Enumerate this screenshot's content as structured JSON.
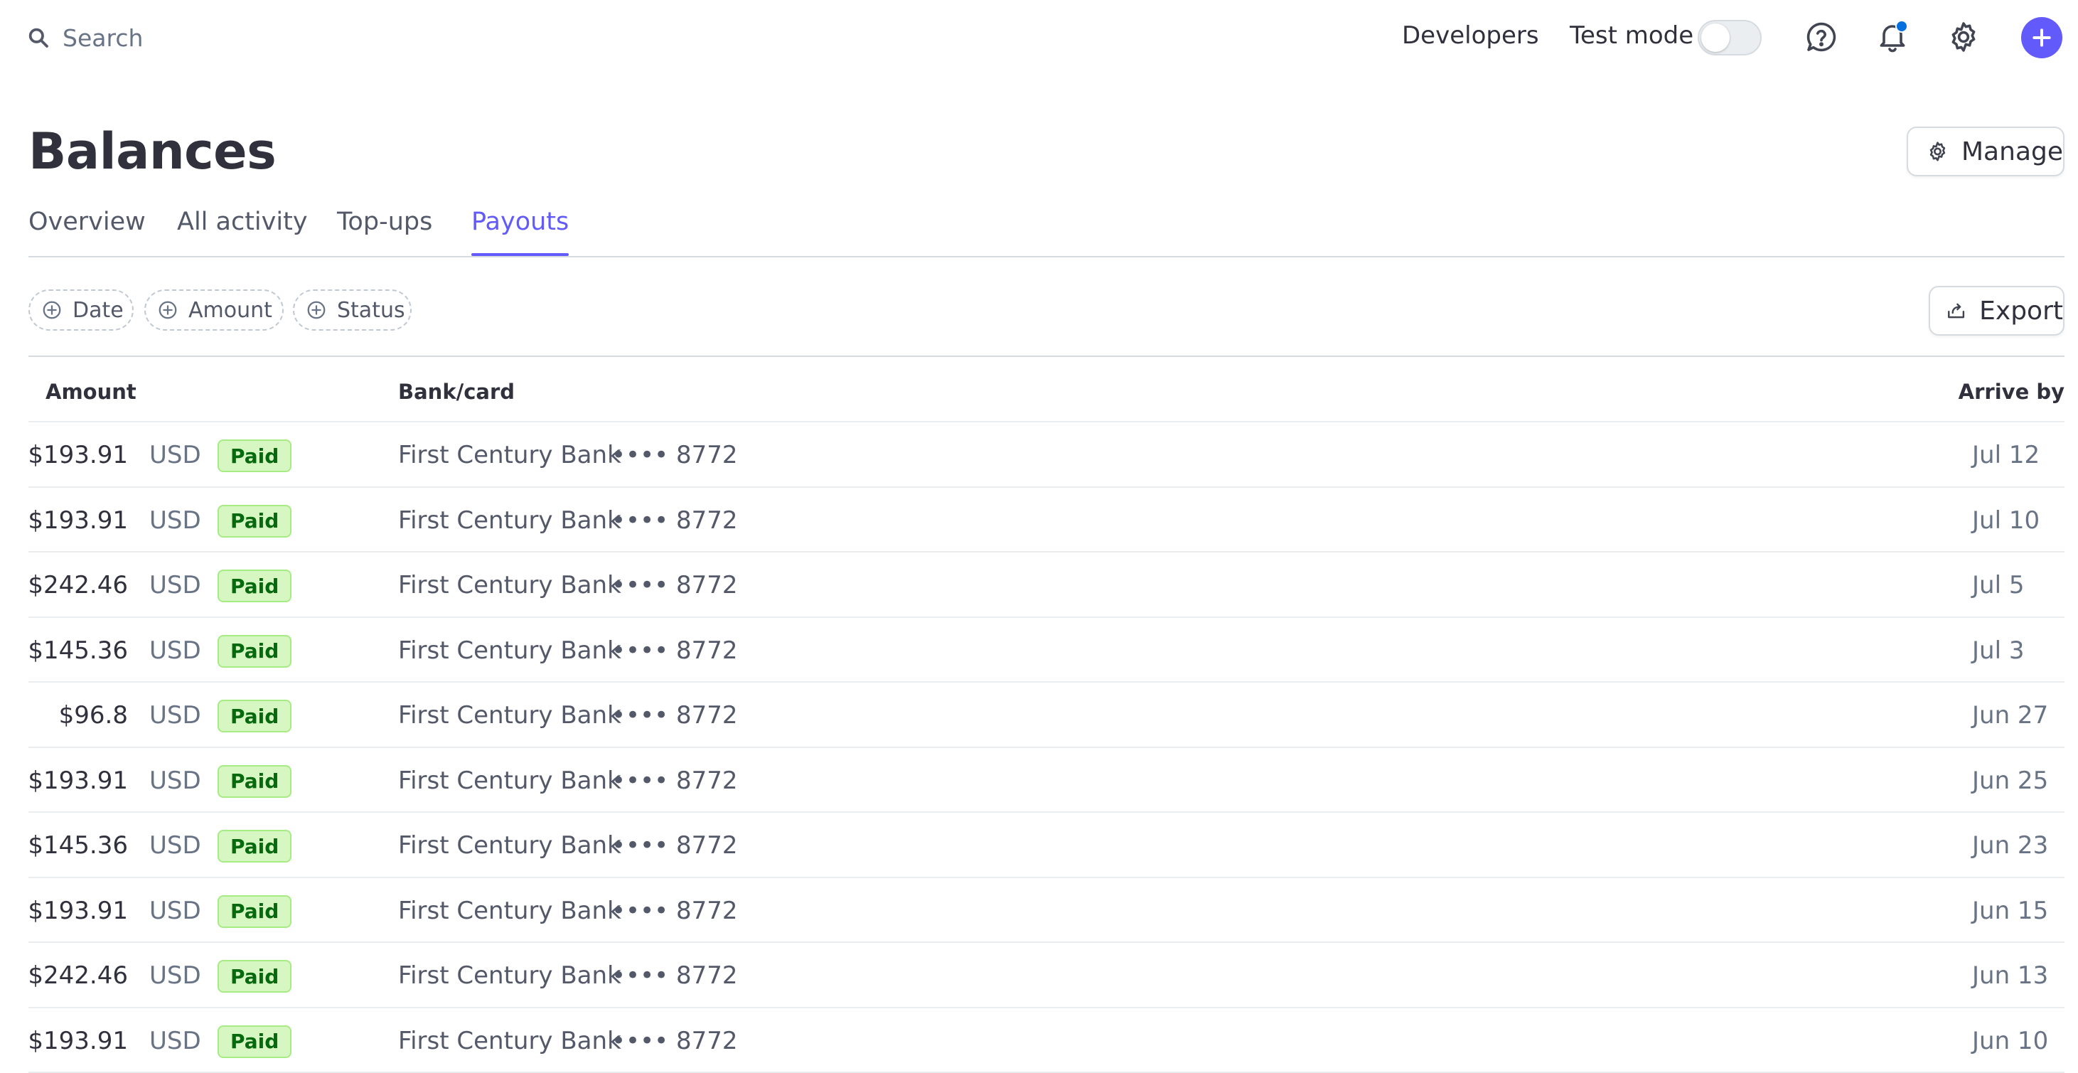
{
  "topbar": {
    "search_placeholder": "Search",
    "developers_label": "Developers",
    "test_mode_label": "Test mode",
    "test_mode_on": false,
    "accent_color": "#625afa",
    "notification_dot_color": "#0570de"
  },
  "header": {
    "title": "Balances",
    "manage_label": "Manage"
  },
  "tabs": [
    {
      "label": "Overview",
      "active": false
    },
    {
      "label": "All activity",
      "active": false
    },
    {
      "label": "Top-ups",
      "active": false
    },
    {
      "label": "Payouts",
      "active": true
    }
  ],
  "filters": {
    "date": "Date",
    "amount": "Amount",
    "status": "Status",
    "export_label": "Export"
  },
  "table": {
    "columns": {
      "amount": "Amount",
      "bank": "Bank/card",
      "arrive": "Arrive by"
    },
    "rows": [
      {
        "amount": "$193.91",
        "currency": "USD",
        "status": "Paid",
        "bank": "First Century Bank",
        "mask": "•••• 8772",
        "arrive": "Jul 12"
      },
      {
        "amount": "$193.91",
        "currency": "USD",
        "status": "Paid",
        "bank": "First Century Bank",
        "mask": "•••• 8772",
        "arrive": "Jul 10"
      },
      {
        "amount": "$242.46",
        "currency": "USD",
        "status": "Paid",
        "bank": "First Century Bank",
        "mask": "•••• 8772",
        "arrive": "Jul 5"
      },
      {
        "amount": "$145.36",
        "currency": "USD",
        "status": "Paid",
        "bank": "First Century Bank",
        "mask": "•••• 8772",
        "arrive": "Jul 3"
      },
      {
        "amount": "$96.8",
        "currency": "USD",
        "status": "Paid",
        "bank": "First Century Bank",
        "mask": "•••• 8772",
        "arrive": "Jun 27"
      },
      {
        "amount": "$193.91",
        "currency": "USD",
        "status": "Paid",
        "bank": "First Century Bank",
        "mask": "•••• 8772",
        "arrive": "Jun 25"
      },
      {
        "amount": "$145.36",
        "currency": "USD",
        "status": "Paid",
        "bank": "First Century Bank",
        "mask": "•••• 8772",
        "arrive": "Jun 23"
      },
      {
        "amount": "$193.91",
        "currency": "USD",
        "status": "Paid",
        "bank": "First Century Bank",
        "mask": "•••• 8772",
        "arrive": "Jun 15"
      },
      {
        "amount": "$242.46",
        "currency": "USD",
        "status": "Paid",
        "bank": "First Century Bank",
        "mask": "•••• 8772",
        "arrive": "Jun 13"
      },
      {
        "amount": "$193.91",
        "currency": "USD",
        "status": "Paid",
        "bank": "First Century Bank",
        "mask": "•••• 8772",
        "arrive": "Jun 10"
      }
    ]
  }
}
